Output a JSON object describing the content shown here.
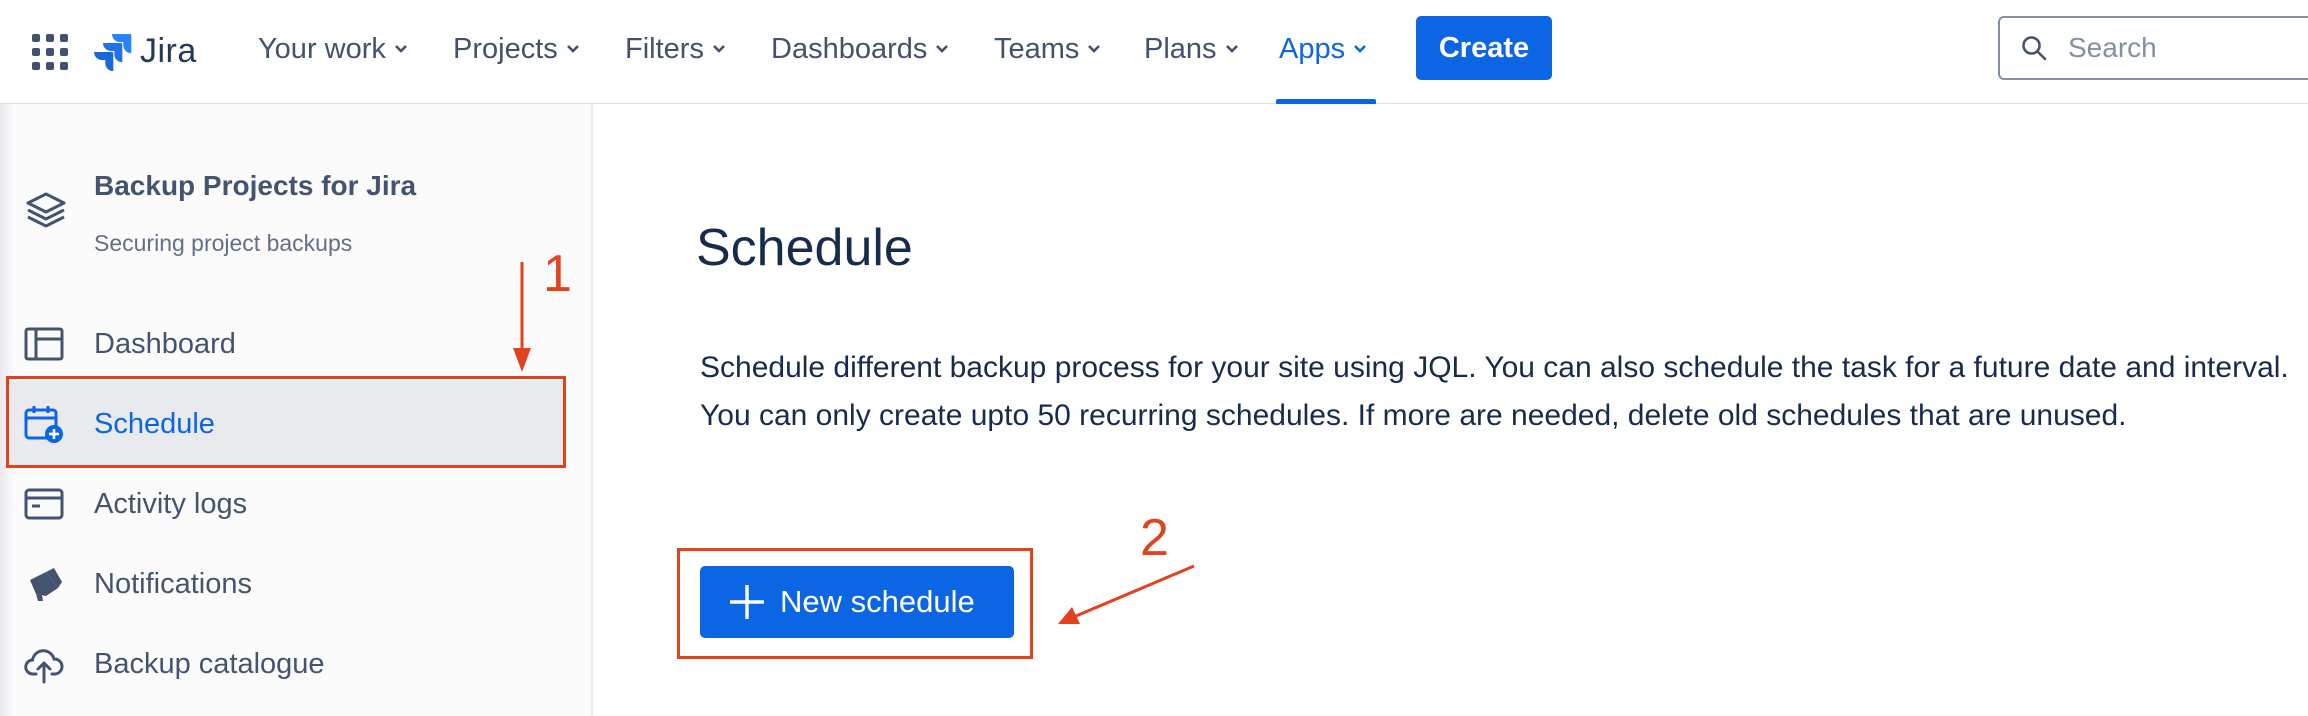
{
  "topnav": {
    "logo_text": "Jira",
    "items": [
      {
        "label": "Your work"
      },
      {
        "label": "Projects"
      },
      {
        "label": "Filters"
      },
      {
        "label": "Dashboards"
      },
      {
        "label": "Teams"
      },
      {
        "label": "Plans"
      },
      {
        "label": "Apps",
        "active": true
      }
    ],
    "create_label": "Create",
    "search_placeholder": "Search"
  },
  "sidebar": {
    "app_title": "Backup Projects for Jira",
    "app_subtitle": "Securing project backups",
    "items": [
      {
        "label": "Dashboard",
        "icon": "dashboard-icon"
      },
      {
        "label": "Schedule",
        "icon": "calendar-add-icon",
        "selected": true
      },
      {
        "label": "Activity logs",
        "icon": "activity-log-icon"
      },
      {
        "label": "Notifications",
        "icon": "megaphone-icon"
      },
      {
        "label": "Backup catalogue",
        "icon": "cloud-upload-icon"
      }
    ]
  },
  "main": {
    "title": "Schedule",
    "description": "Schedule different backup process for your site using JQL. You can also schedule the task for a future date and interval. You can only create upto 50 recurring schedules. If more are needed, delete old schedules that are unused.",
    "new_button_label": "New schedule"
  },
  "annotations": {
    "step1": "1",
    "step2": "2"
  },
  "colors": {
    "accent": "#0c66e4",
    "annotation": "#e2421e",
    "text": "#172b4d",
    "subtle_text": "#44546f"
  }
}
